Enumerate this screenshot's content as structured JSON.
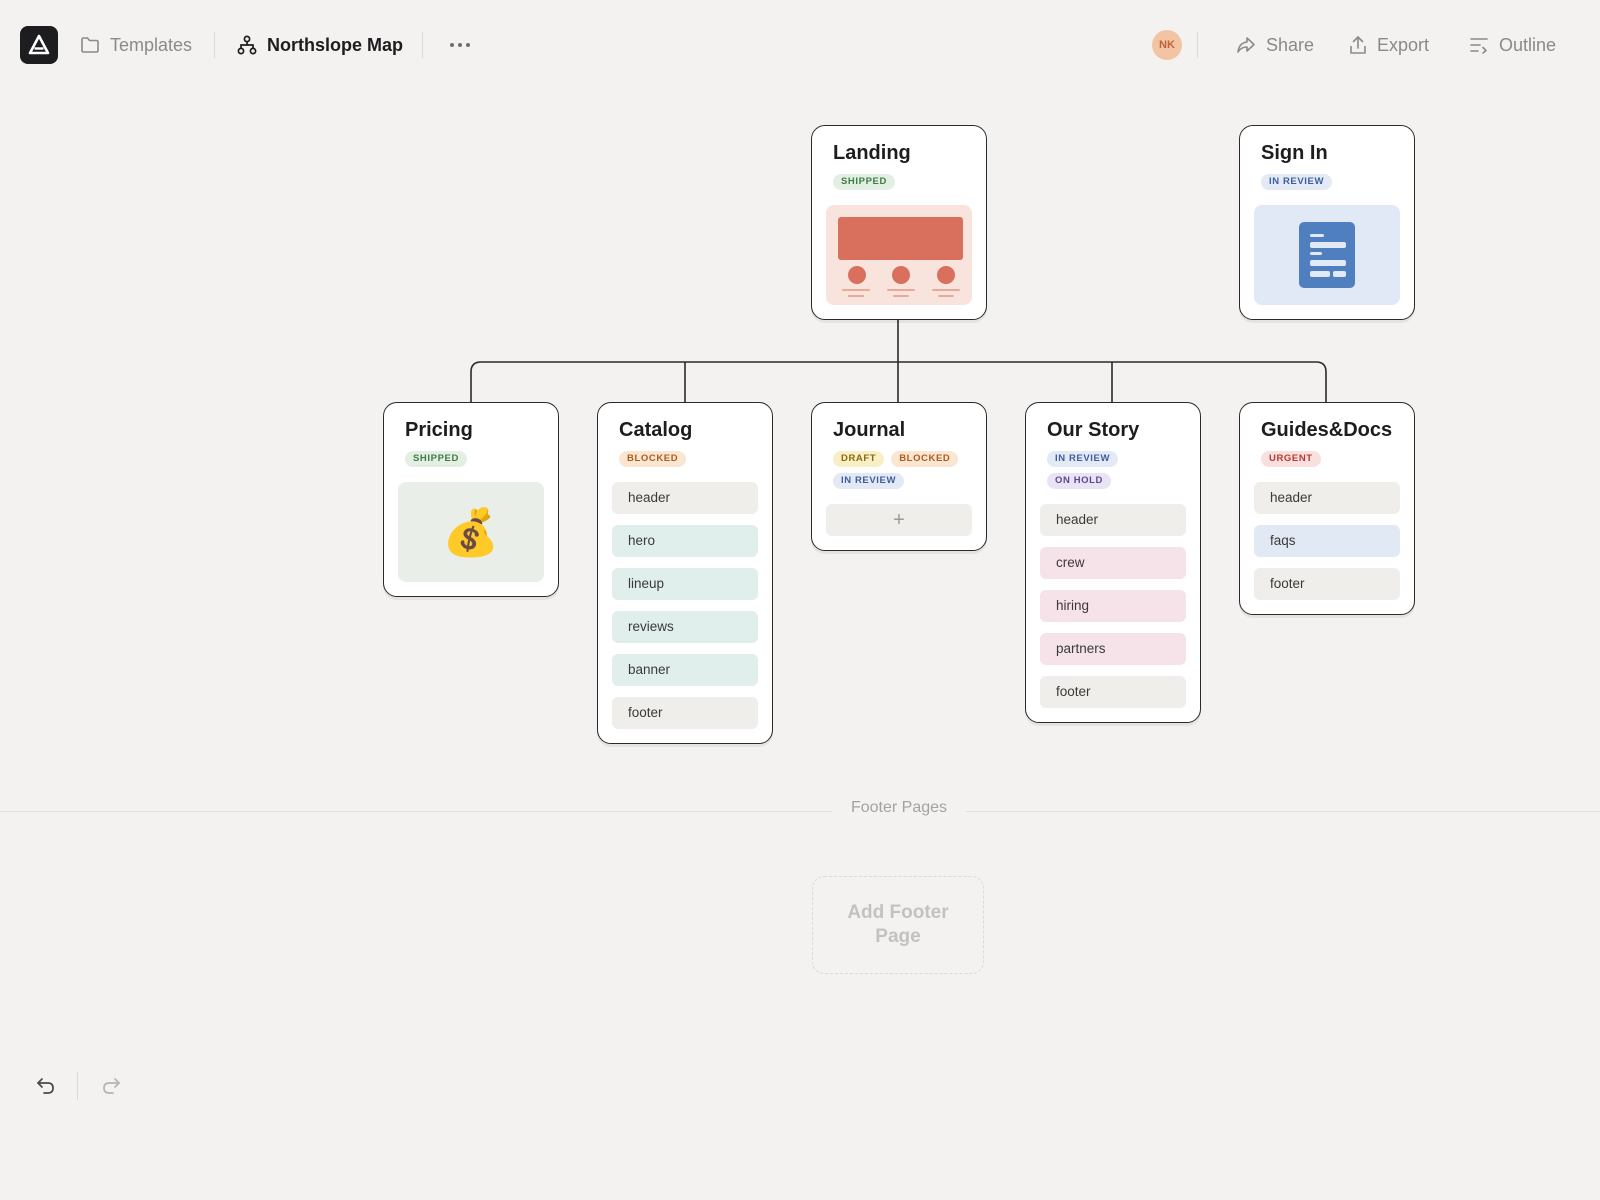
{
  "app": {
    "logo_icon": "app-logo-icon"
  },
  "breadcrumb": {
    "templates": {
      "label": "Templates",
      "icon": "folder-icon"
    },
    "current": {
      "label": "Northslope Map",
      "icon": "sitemap-icon"
    },
    "more_icon": "more-horizontal-icon"
  },
  "user": {
    "initials": "NK",
    "color": "#f3c4a3"
  },
  "toolbar": {
    "share": {
      "label": "Share",
      "icon": "share-icon"
    },
    "export": {
      "label": "Export",
      "icon": "upload-icon"
    },
    "outline": {
      "label": "Outline",
      "icon": "outline-list-icon"
    }
  },
  "badge_colors": {
    "SHIPPED": "#3e7d47",
    "IN REVIEW": "#3d5f9b",
    "BLOCKED": "#b05a1f",
    "DRAFT": "#8a6a10",
    "ON HOLD": "#5c4891",
    "URGENT": "#b53a32"
  },
  "pages": {
    "landing": {
      "title": "Landing",
      "badges": [
        "SHIPPED"
      ],
      "thumbnail": "landing-wireframe"
    },
    "signin": {
      "title": "Sign In",
      "badges": [
        "IN REVIEW"
      ],
      "thumbnail": "document-icon"
    },
    "pricing": {
      "title": "Pricing",
      "badges": [
        "SHIPPED"
      ],
      "thumbnail": "💰"
    },
    "catalog": {
      "title": "Catalog",
      "badges": [
        "BLOCKED"
      ],
      "sections": [
        "header",
        "hero",
        "lineup",
        "reviews",
        "banner",
        "footer"
      ]
    },
    "journal": {
      "title": "Journal",
      "badges": [
        "DRAFT",
        "BLOCKED",
        "IN REVIEW"
      ],
      "add_label": "+"
    },
    "ourstory": {
      "title": "Our Story",
      "badges": [
        "IN REVIEW",
        "ON HOLD"
      ],
      "sections": [
        "header",
        "crew",
        "hiring",
        "partners",
        "footer"
      ]
    },
    "guides": {
      "title": "Guides&Docs",
      "badges": [
        "URGENT"
      ],
      "sections": [
        "header",
        "faqs",
        "footer"
      ]
    }
  },
  "footer": {
    "label": "Footer Pages",
    "add_label": "Add Footer Page"
  },
  "history": {
    "undo_icon": "undo-icon",
    "redo_icon": "redo-icon"
  }
}
